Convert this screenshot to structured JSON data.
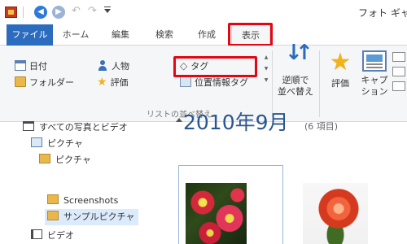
{
  "window": {
    "title": "フォト ギャ"
  },
  "quick_access": {
    "app_icon": "photo-gallery-icon",
    "back_icon": "back-arrow-icon",
    "forward_icon": "forward-arrow-icon",
    "undo_icon": "undo-icon",
    "redo_icon": "redo-icon",
    "customize_icon": "qat-customize-icon"
  },
  "ribbon": {
    "tabs": [
      {
        "label": "ファイル"
      },
      {
        "label": "ホーム"
      },
      {
        "label": "編集"
      },
      {
        "label": "検索"
      },
      {
        "label": "作成"
      },
      {
        "label": "表示"
      }
    ],
    "sort_group": {
      "items": [
        {
          "label": "日付",
          "icon": "calendar-icon"
        },
        {
          "label": "フォルダー",
          "icon": "folder-icon"
        },
        {
          "label": "人物",
          "icon": "person-icon"
        },
        {
          "label": "評価",
          "icon": "star-icon"
        },
        {
          "label": "タグ",
          "icon": "tag-icon"
        },
        {
          "label": "位置情報タグ",
          "icon": "geotag-icon"
        }
      ],
      "label": "リストの並べ替え"
    },
    "reverse_sort": {
      "line1": "逆順で",
      "line2": "並べ替え"
    },
    "rating_button": {
      "label": "評価"
    },
    "caption_button": {
      "line1": "キャプ",
      "line2": "ション"
    }
  },
  "tree": [
    {
      "label": "すべての写真とビデオ",
      "icon": "all-photos-icon"
    },
    {
      "label": "ピクチャ",
      "icon": "pictures-icon"
    },
    {
      "label": "ピクチャ",
      "icon": "folder-icon"
    },
    {
      "label": "Screenshots",
      "icon": "folder-icon"
    },
    {
      "label": "サンプルピクチャ",
      "icon": "folder-icon"
    },
    {
      "label": "ビデオ",
      "icon": "video-icon"
    }
  ],
  "gallery": {
    "section_title": "2010年9月",
    "count": "(6 項目)"
  },
  "highlight_color": "#e30613",
  "accent_color": "#2b6cbe"
}
